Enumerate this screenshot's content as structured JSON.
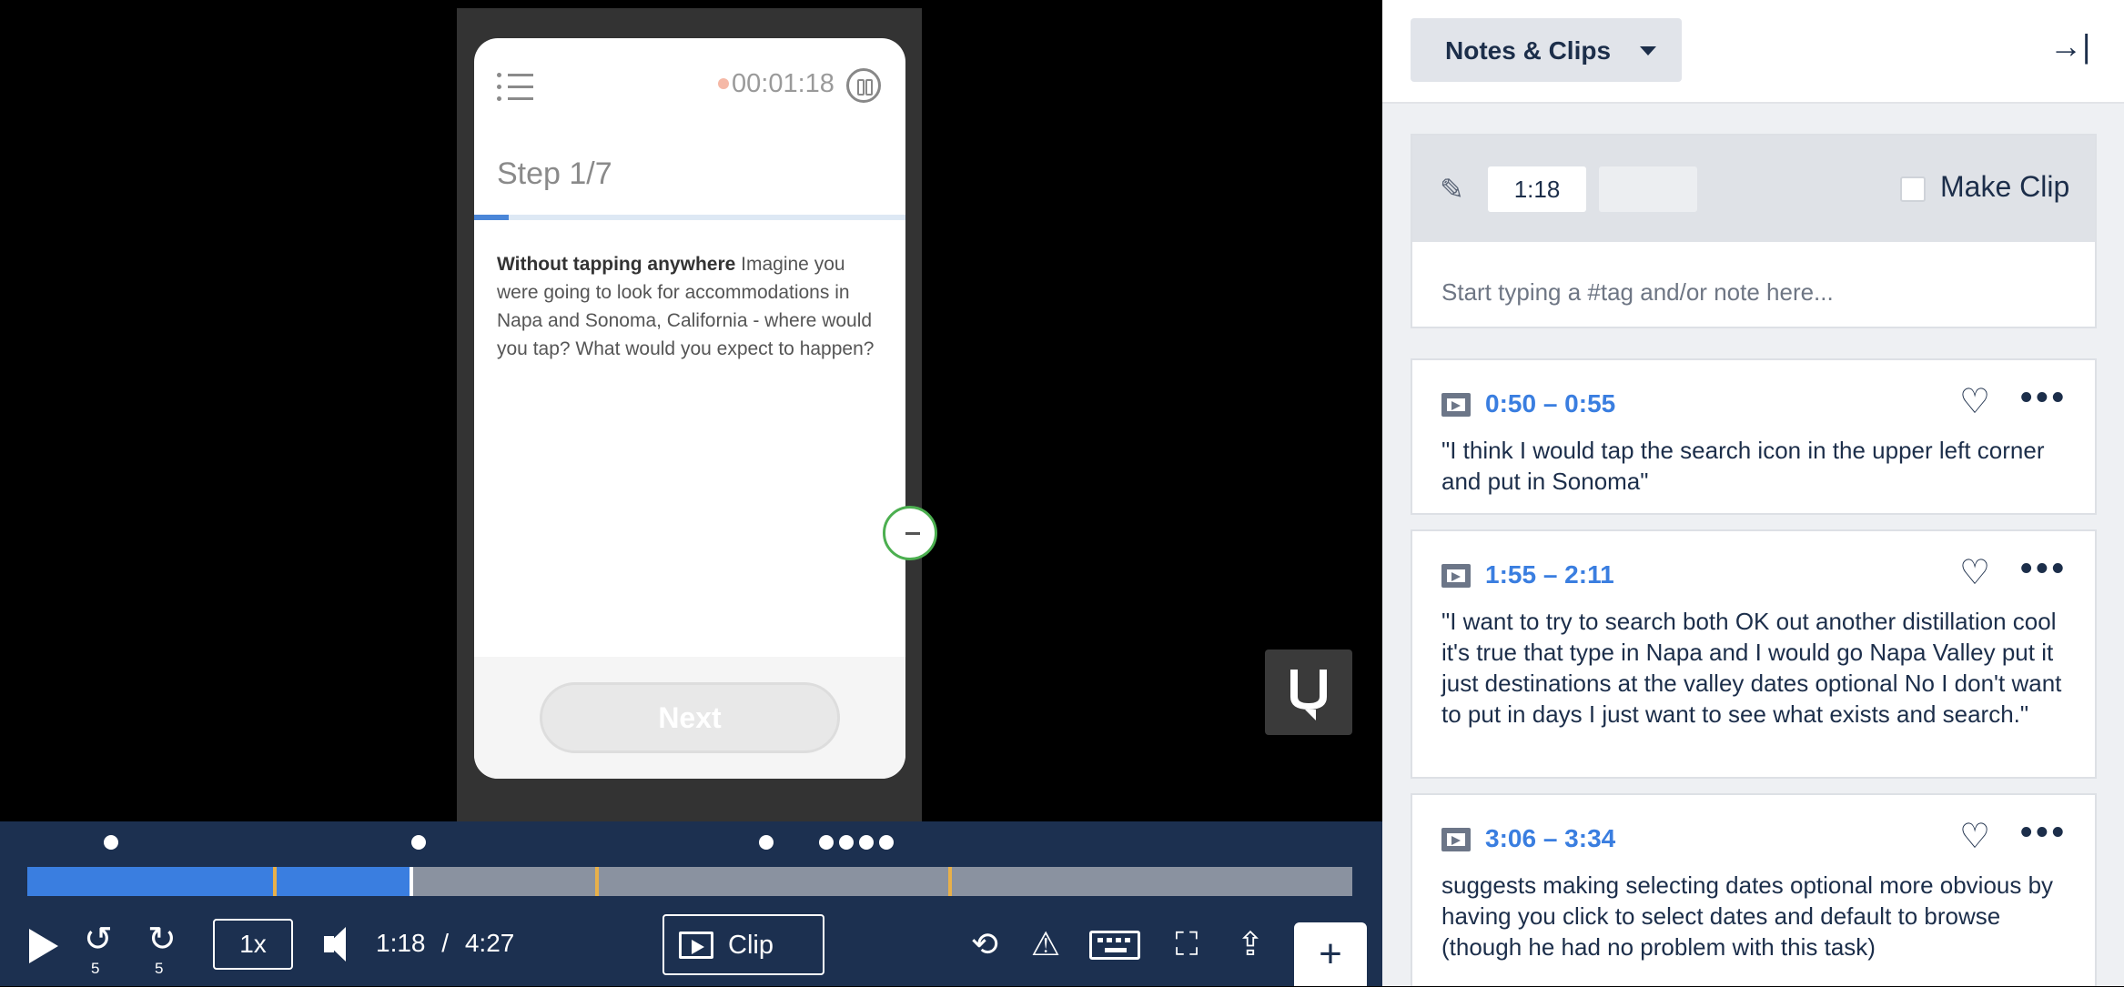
{
  "video": {
    "recording_time": "00:01:18",
    "step_label": "Step 1/7",
    "step_progress": 0.08,
    "task_bold": "Without tapping anywhere",
    "task_text": " Imagine you were going to look for accommodations in Napa and Sonoma, California - where would you tap? What would you expect to happen?",
    "next_label": "Next"
  },
  "player": {
    "speed": "1x",
    "current_time": "1:18",
    "separator": "/",
    "duration": "4:27",
    "skip_back": "5",
    "skip_forward": "5",
    "clip_label": "Clip",
    "add_label": "+",
    "played_fraction": 0.29
  },
  "notes": {
    "dropdown_label": "Notes & Clips",
    "collapse_label": "→|",
    "compose": {
      "start_time": "1:18",
      "end_time": "",
      "make_clip_label": "Make Clip",
      "placeholder": "Start typing a #tag and/or note here..."
    },
    "cards": [
      {
        "range": "0:50 – 0:55",
        "text": "\"I think I would tap the search icon in the upper left corner and put in Sonoma\""
      },
      {
        "range": "1:55 – 2:11",
        "text": "\"I want to try to search both OK out another distillation cool it's true that type in Napa and I would go Napa Valley put it just destinations at the valley dates optional No I don't want to put in days I just want to see what exists and search.\""
      },
      {
        "range": "3:06 – 3:34",
        "text": "suggests making selecting dates optional more obvious by having you click to select dates and default to browse (though he had no problem with this task)"
      }
    ]
  }
}
